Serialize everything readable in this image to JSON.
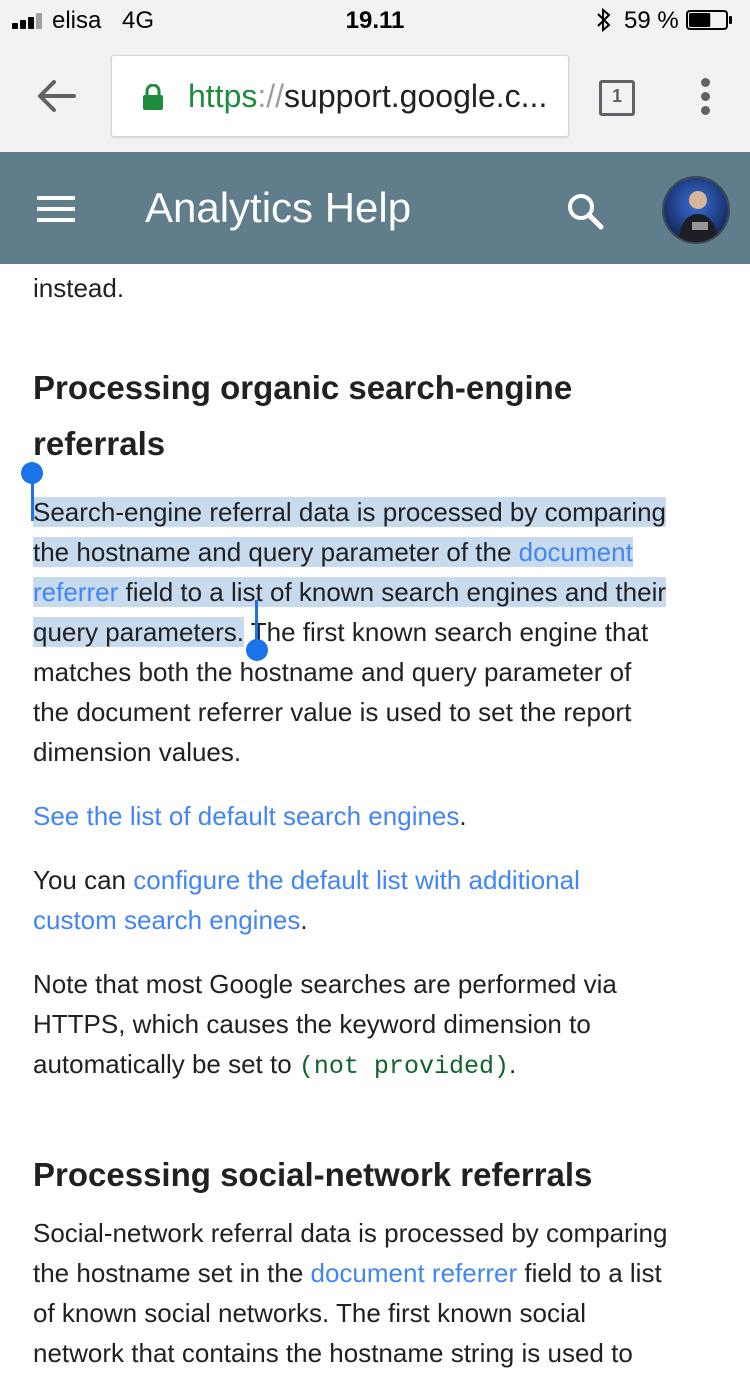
{
  "status_bar": {
    "carrier": "elisa",
    "network": "4G",
    "time": "19.11",
    "battery_percent": "59 %",
    "battery_level": 0.59
  },
  "browser": {
    "url_scheme": "https",
    "url_separator": "://",
    "url_host": "support.google.c...",
    "tab_count": "1"
  },
  "app_bar": {
    "title": "Analytics Help"
  },
  "article": {
    "prev_tail": "instead.",
    "section1": {
      "heading_line1": "Processing organic search-engine",
      "heading_line2": "referrals",
      "para1": {
        "selected_l1": "Search-engine referral data is processed by comparing",
        "selected_l2a": "the hostname and query parameter of the ",
        "link1_a": "document",
        "link1_b": "referrer",
        "selected_l3b": " field to a list of known search engines and their",
        "selected_l4": "query parameters.",
        "rest_l4": " The first known search engine that",
        "rest_l5": "matches both the hostname and query parameter of",
        "rest_l6": "the document referrer value is used to set the report",
        "rest_l7": "dimension values."
      },
      "para2": {
        "link": "See the list of default search engines",
        "tail": "."
      },
      "para3": {
        "prefix": "You can ",
        "link_l1": "configure the default list with additional",
        "link_l2": "custom search engines",
        "tail": "."
      },
      "para4": {
        "l1": "Note that most Google searches are performed via",
        "l2": "HTTPS, which causes the keyword dimension to",
        "l3_prefix": "automatically be set to ",
        "code": "(not provided)",
        "tail": "."
      }
    },
    "section2": {
      "heading": "Processing social-network referrals",
      "para1": {
        "l1": "Social-network referral data is processed by comparing",
        "l2_prefix": "the hostname set in the ",
        "link": "document referrer",
        "l2_suffix": " field to a list",
        "l3": "of known social networks. The first known social",
        "l4": "network that contains the hostname string is used to"
      }
    }
  },
  "colors": {
    "app_bar": "#607d8b",
    "link": "#4285f4",
    "selection": "#c8daee",
    "selection_handle": "#1a73e8",
    "secure_scheme": "#1e8e3e"
  },
  "icons": {
    "back": "arrow-left-icon",
    "lock": "lock-icon",
    "menu": "hamburger-icon",
    "search": "search-icon",
    "overflow": "more-vert-icon"
  }
}
